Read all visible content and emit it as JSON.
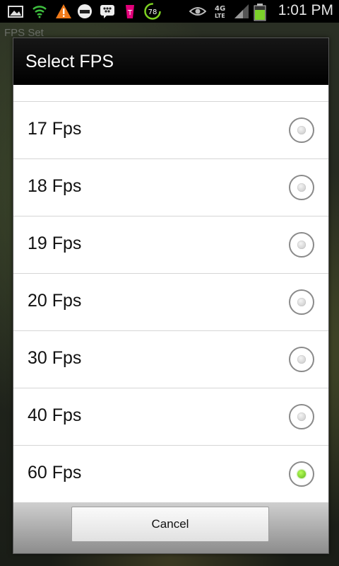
{
  "status_bar": {
    "time": "1:01 PM",
    "battery_level": 0.7,
    "icons": [
      "image-icon",
      "wifi-icon",
      "warning-icon",
      "helmet-icon",
      "bbm-icon",
      "t-mobile-icon",
      "badge-78-icon",
      "eye-icon",
      "4g-lte-icon",
      "signal-icon",
      "battery-icon"
    ],
    "badge_count": "78",
    "network": "4G LTE"
  },
  "background_app": {
    "title": "FPS Set"
  },
  "dialog": {
    "title": "Select FPS",
    "options": [
      {
        "label": "17 Fps",
        "selected": false
      },
      {
        "label": "18 Fps",
        "selected": false
      },
      {
        "label": "19 Fps",
        "selected": false
      },
      {
        "label": "20 Fps",
        "selected": false
      },
      {
        "label": "30 Fps",
        "selected": false
      },
      {
        "label": "40 Fps",
        "selected": false
      },
      {
        "label": "60 Fps",
        "selected": true
      }
    ],
    "cancel_label": "Cancel"
  },
  "colors": {
    "header_bg": "#000000",
    "radio_selected": "#6cc524",
    "status_icon_green": "#3fbf3f",
    "warning_orange": "#f07a1a",
    "tmobile_magenta": "#e2007a"
  }
}
